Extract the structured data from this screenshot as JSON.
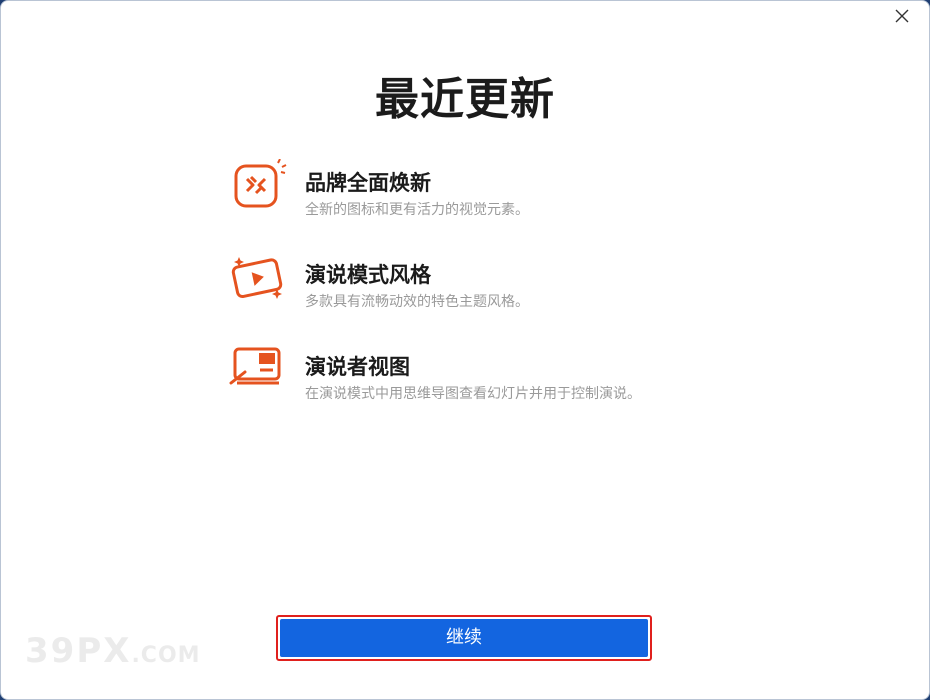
{
  "dialog": {
    "title": "最近更新",
    "close_icon": "close-icon"
  },
  "features": [
    {
      "icon": "brand-refresh-icon",
      "title": "品牌全面焕新",
      "description": "全新的图标和更有活力的视觉元素。"
    },
    {
      "icon": "presentation-play-icon",
      "title": "演说模式风格",
      "description": "多款具有流畅动效的特色主题风格。"
    },
    {
      "icon": "presenter-view-icon",
      "title": "演说者视图",
      "description": "在演说模式中用思维导图查看幻灯片并用于控制演说。"
    }
  ],
  "footer": {
    "continue_label": "继续"
  },
  "watermark": {
    "main": "39PX",
    "suffix": ".COM"
  },
  "colors": {
    "accent": "#e5531f",
    "primary_button": "#1365e0",
    "highlight_border": "#e0201d"
  }
}
